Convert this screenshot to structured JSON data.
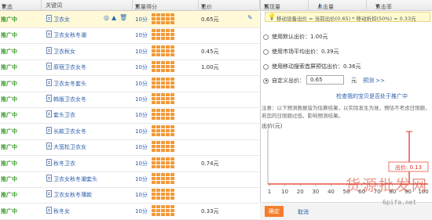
{
  "header": {
    "status": "状态",
    "keyword": "关键词",
    "quality": "质量得分",
    "price": "出价",
    "rank": "展现量",
    "clicks": "点击量",
    "ctr": "点击率"
  },
  "rows": [
    {
      "status": "推广中",
      "keyword": "卫衣女",
      "score": "10分",
      "price": "0.65元",
      "selected": true
    },
    {
      "status": "推广中",
      "keyword": "卫衣女秋冬潮",
      "score": "10分",
      "price": ""
    },
    {
      "status": "推广中",
      "keyword": "卫衣秋女",
      "score": "10分",
      "price": "0.45元"
    },
    {
      "status": "推广中",
      "keyword": "原宿卫衣女冬",
      "score": "10分",
      "price": "1.00元"
    },
    {
      "status": "推广中",
      "keyword": "卫衣女冬套头",
      "score": "10分",
      "price": ""
    },
    {
      "status": "推广中",
      "keyword": "韩版卫衣女冬",
      "score": "10分",
      "price": ""
    },
    {
      "status": "推广中",
      "keyword": "套头卫衣",
      "score": "10分",
      "price": ""
    },
    {
      "status": "推广中",
      "keyword": "长款卫衣女冬",
      "score": "10分",
      "price": ""
    },
    {
      "status": "推广中",
      "keyword": "大宽松卫衣女",
      "score": "10分",
      "price": ""
    },
    {
      "status": "推广中",
      "keyword": "秋冬卫衣",
      "score": "10分",
      "price": "0.74元"
    },
    {
      "status": "推广中",
      "keyword": "卫衣女秋冬潮套头",
      "score": "10分",
      "price": ""
    },
    {
      "status": "推广中",
      "keyword": "卫衣女秋冬薄款",
      "score": "10分",
      "price": ""
    },
    {
      "status": "推广中",
      "keyword": "秋冬女",
      "score": "10分",
      "price": "0.33元"
    }
  ],
  "panel": {
    "tip": "移动设备出价 = 当前出价(0.65) * 移动折扣(50%) = 0.33元",
    "opt1": "使用默认出价：1.00元",
    "opt2": "使用市场平均出价：0.39元",
    "opt3": "使用移动搜索首屏预估出价：0.36元",
    "opt4": "自定义出价：",
    "custom_value": "0.65",
    "unit": "元",
    "predict": "预测 >>",
    "check_link": "检查我的宝贝是否处于推广中",
    "note": "注意：以下预测数据皆为估算结果，以实际发生为准，预估不考虑日限额，若您的日限额过低，影响预测结果。",
    "ylabel": "出价(元)",
    "bubble": "出价: 0.13",
    "ok": "确定",
    "cancel": "取消"
  },
  "chart_data": {
    "type": "line",
    "x": [
      1,
      10,
      20,
      30,
      40,
      50,
      60,
      70,
      80,
      90,
      100
    ],
    "xticks": [
      "1",
      "10",
      "20",
      "30",
      "40",
      "50",
      "60",
      "70",
      "80",
      "90",
      "100"
    ],
    "ylabel": "出价(元)",
    "marker_value": 0.13
  },
  "watermark": {
    "main": "货源批发网",
    "url": "6pifa.net"
  },
  "colors": {
    "accent": "#f57d2a",
    "status_green": "#3a9a2a",
    "link": "#2a5caa",
    "bar": "#f29a3a"
  }
}
